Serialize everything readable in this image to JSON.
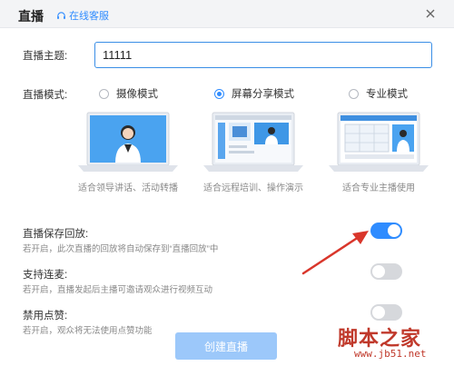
{
  "header": {
    "title": "直播",
    "customer_service": "在线客服"
  },
  "form": {
    "topic_label": "直播主题:",
    "topic_value": "11111",
    "mode_label": "直播模式:",
    "modes": [
      {
        "label": "摄像模式",
        "caption": "适合领导讲话、活动转播",
        "selected": false
      },
      {
        "label": "屏幕分享模式",
        "caption": "适合远程培训、操作演示",
        "selected": true
      },
      {
        "label": "专业模式",
        "caption": "适合专业主播使用",
        "selected": false
      }
    ]
  },
  "settings": [
    {
      "title": "直播保存回放:",
      "desc": "若开启，此次直播的回放将自动保存到“直播回放”中",
      "enabled": true
    },
    {
      "title": "支持连麦:",
      "desc": "若开启，直播发起后主播可邀请观众进行视频互动",
      "enabled": false
    },
    {
      "title": "禁用点赞:",
      "desc": "若开启，观众将无法使用点赞功能",
      "enabled": false
    }
  ],
  "create_button": "创建直播",
  "watermark": {
    "logo": "脚本之家",
    "url": "www.jb51.net"
  },
  "colors": {
    "accent": "#2f8cff",
    "button_disabled": "#9cc8fa",
    "toggle_off": "#d6d8dc",
    "arrow": "#d9362b"
  }
}
